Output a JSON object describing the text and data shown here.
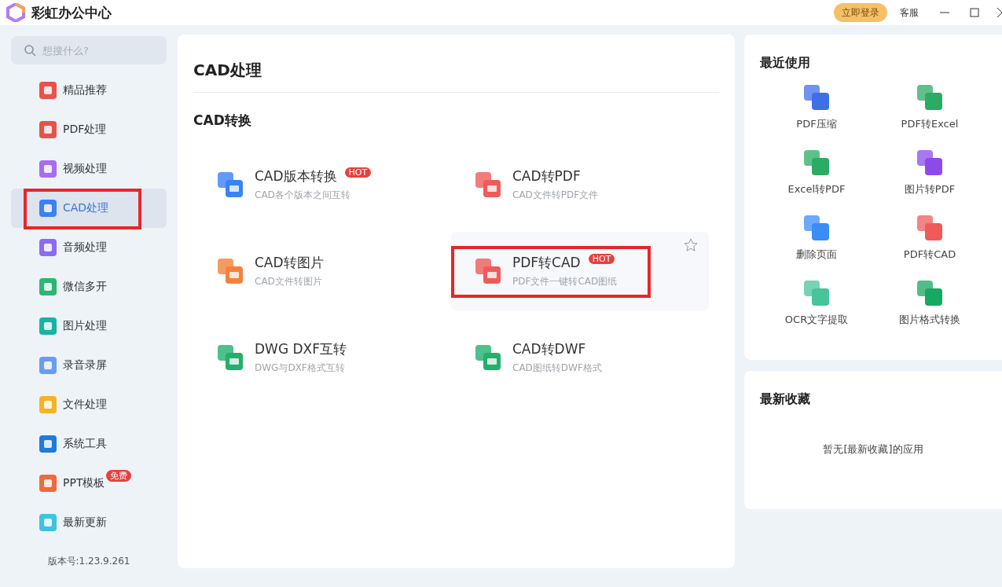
{
  "window": {
    "title": "彩虹办公中心",
    "login_button": "立即登录",
    "service_link": "客服"
  },
  "sidebar": {
    "search": {
      "placeholder": "想搜什么?"
    },
    "items": [
      {
        "label": "精品推荐",
        "selected": false,
        "highlighted": false
      },
      {
        "label": "PDF处理",
        "selected": false,
        "highlighted": false
      },
      {
        "label": "视频处理",
        "selected": false,
        "highlighted": false
      },
      {
        "label": "CAD处理",
        "selected": true,
        "highlighted": true
      },
      {
        "label": "音频处理",
        "selected": false,
        "highlighted": false
      },
      {
        "label": "微信多开",
        "selected": false,
        "highlighted": false
      },
      {
        "label": "图片处理",
        "selected": false,
        "highlighted": false
      },
      {
        "label": "录音录屏",
        "selected": false,
        "highlighted": false
      },
      {
        "label": "文件处理",
        "selected": false,
        "highlighted": false
      },
      {
        "label": "系统工具",
        "selected": false,
        "highlighted": false
      },
      {
        "label": "PPT模板",
        "badge": "免费",
        "selected": false,
        "highlighted": false
      },
      {
        "label": "最新更新",
        "selected": false,
        "highlighted": false
      }
    ],
    "version": "版本号:1.23.9.261"
  },
  "main": {
    "title": "CAD处理",
    "section": "CAD转换",
    "tools": [
      {
        "name": "CAD版本转换",
        "badge": "HOT",
        "description": "CAD各个版本之间互转",
        "hovered": false,
        "highlighted": false
      },
      {
        "name": "CAD转PDF",
        "description": "CAD文件转PDF文件",
        "hovered": false,
        "highlighted": false
      },
      {
        "name": "CAD转图片",
        "description": "CAD文件转图片",
        "hovered": false,
        "highlighted": false
      },
      {
        "name": "PDF转CAD",
        "badge": "HOT",
        "description": "PDF文件一键转CAD图纸",
        "hovered": true,
        "highlighted": true
      },
      {
        "name": "DWG DXF互转",
        "description": "DWG与DXF格式互转",
        "hovered": false,
        "highlighted": false
      },
      {
        "name": "CAD转DWF",
        "description": "CAD图纸转DWF格式",
        "hovered": false,
        "highlighted": false
      }
    ]
  },
  "recent": {
    "title": "最近使用",
    "items": [
      "PDF压缩",
      "PDF转Excel",
      "Excel转PDF",
      "图片转PDF",
      "删除页面",
      "PDF转CAD",
      "OCR文字提取",
      "图片格式转换"
    ]
  },
  "favorites": {
    "title": "最新收藏",
    "empty_message": "暂无[最新收藏]的应用"
  }
}
